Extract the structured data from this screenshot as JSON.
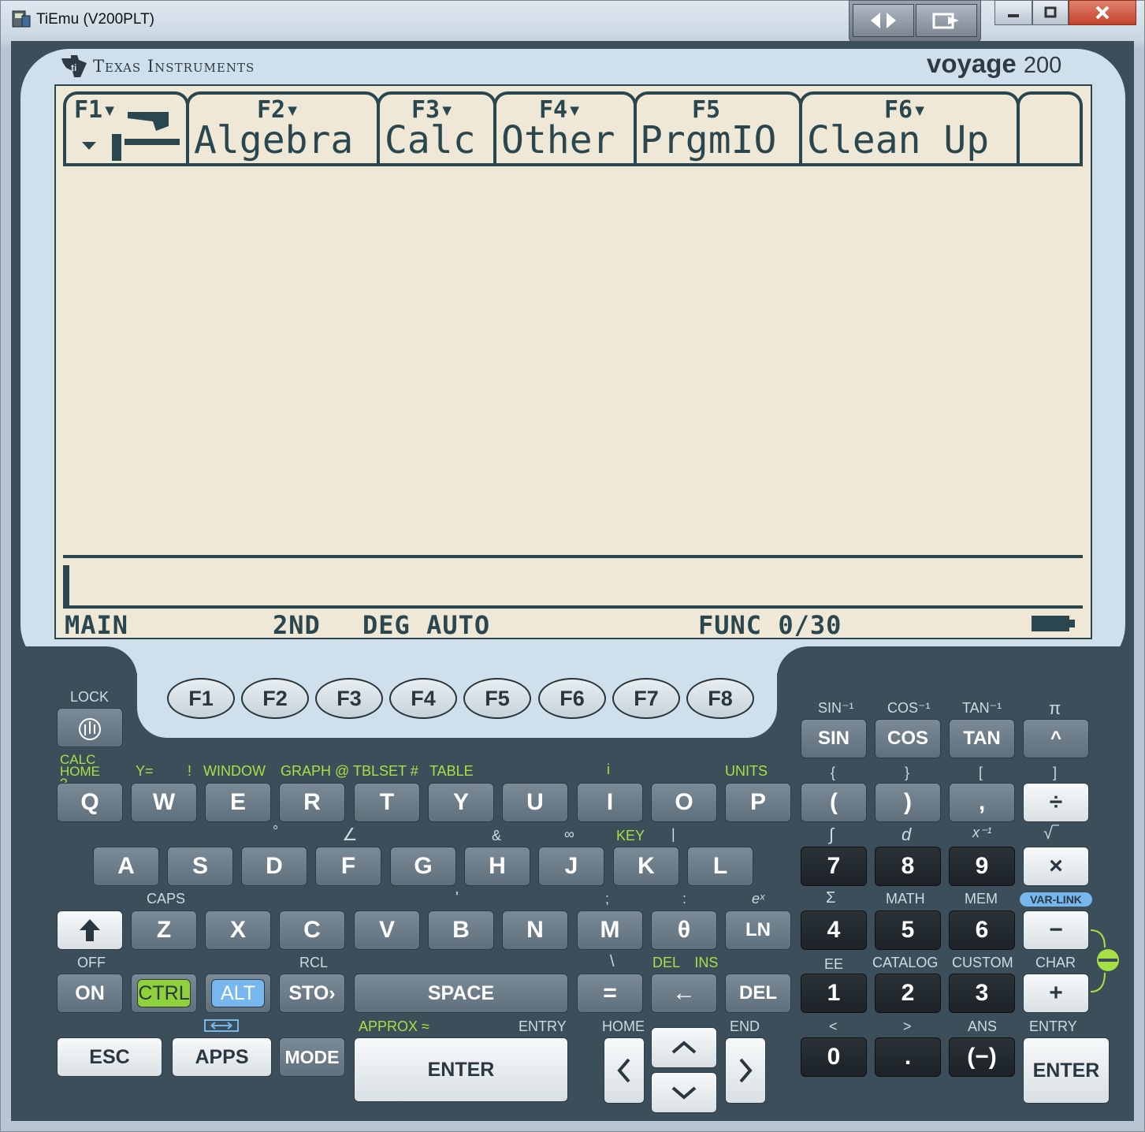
{
  "window": {
    "title": "TiEmu (V200PLT)",
    "buttons": {
      "minimize": "minimize-icon",
      "restore": "restore-icon",
      "close": "close-icon"
    }
  },
  "calculator": {
    "brand": "Texas Instruments",
    "model_name": "voyage",
    "model_number": "200",
    "screen": {
      "toolbar": [
        {
          "fn": "F1▾",
          "label": ""
        },
        {
          "fn": "F2▾",
          "label": "Algebra"
        },
        {
          "fn": "F3▾",
          "label": "Calc"
        },
        {
          "fn": "F4▾",
          "label": "Other"
        },
        {
          "fn": "F5",
          "label": "PrgmIO"
        },
        {
          "fn": "F6▾",
          "label": "Clean Up"
        }
      ],
      "status": {
        "mode": "MAIN",
        "second": "2ND",
        "angle": "DEG AUTO",
        "func": "FUNC 0/30"
      }
    },
    "fkeys": [
      "F1",
      "F2",
      "F3",
      "F4",
      "F5",
      "F6",
      "F7",
      "F8"
    ],
    "keys": {
      "lock": "LOCK",
      "row_sin": [
        {
          "label": "SIN",
          "second": "SIN⁻¹"
        },
        {
          "label": "COS",
          "second": "COS⁻¹"
        },
        {
          "label": "TAN",
          "second": "TAN⁻¹"
        },
        {
          "label": "^",
          "second": "π"
        }
      ],
      "row_q": [
        {
          "label": "Q",
          "second": "CALC HOME ?"
        },
        {
          "label": "W",
          "second": "Y="
        },
        {
          "label": "E",
          "second": "!"
        },
        {
          "label": "R",
          "second": "WINDOW"
        },
        {
          "label": "T",
          "second": "GRAPH @"
        },
        {
          "label": "Y",
          "second": "TBLSET #"
        },
        {
          "label": "U",
          "second": "TABLE"
        },
        {
          "label": "I",
          "second": "i"
        },
        {
          "label": "O",
          "second": ""
        },
        {
          "label": "P",
          "second": "UNITS"
        },
        {
          "label": "(",
          "second": "{"
        },
        {
          "label": ")",
          "second": "}"
        },
        {
          "label": ",",
          "second": "["
        },
        {
          "label": "÷",
          "second": "]"
        }
      ],
      "row_a": [
        {
          "label": "A",
          "second": ""
        },
        {
          "label": "S",
          "second": "°"
        },
        {
          "label": "D",
          "second": ""
        },
        {
          "label": "F",
          "second": "∠"
        },
        {
          "label": "G",
          "second": ""
        },
        {
          "label": "H",
          "second": "&"
        },
        {
          "label": "J",
          "second": "∞"
        },
        {
          "label": "K",
          "second": "KEY"
        },
        {
          "label": "L",
          "second": "|"
        },
        {
          "label": "7",
          "second": "∫"
        },
        {
          "label": "8",
          "second": "d"
        },
        {
          "label": "9",
          "second": "x⁻¹"
        },
        {
          "label": "×",
          "second": "√‾"
        }
      ],
      "row_z": [
        {
          "label": "↑",
          "second": "CAPS"
        },
        {
          "label": "Z",
          "second": ""
        },
        {
          "label": "X",
          "second": ""
        },
        {
          "label": "C",
          "second": ""
        },
        {
          "label": "V",
          "second": ""
        },
        {
          "label": "B",
          "second": "'"
        },
        {
          "label": "N",
          "second": ""
        },
        {
          "label": "M",
          "second": ";"
        },
        {
          "label": "θ",
          "second": ":"
        },
        {
          "label": "LN",
          "second": "eˣ"
        },
        {
          "label": "4",
          "second": "Σ"
        },
        {
          "label": "5",
          "second": "MATH"
        },
        {
          "label": "6",
          "second": "MEM"
        },
        {
          "label": "−",
          "second": "VAR-LINK"
        }
      ],
      "row_on": [
        {
          "label": "ON",
          "second": "OFF"
        },
        {
          "label": "CTRL",
          "second": ""
        },
        {
          "label": "ALT",
          "second": ""
        },
        {
          "label": "STO›",
          "second": "RCL"
        },
        {
          "label": "SPACE",
          "second": ""
        },
        {
          "label": "=",
          "second": "\\"
        },
        {
          "label": "←",
          "second": "DEL INS"
        },
        {
          "label": "DEL",
          "second": ""
        },
        {
          "label": "1",
          "second": "EE"
        },
        {
          "label": "2",
          "second": "CATALOG"
        },
        {
          "label": "3",
          "second": "CUSTOM"
        },
        {
          "label": "+",
          "second": "CHAR"
        }
      ],
      "row_esc": [
        {
          "label": "ESC",
          "second": ""
        },
        {
          "label": "APPS",
          "second": ""
        },
        {
          "label": "MODE",
          "second": ""
        },
        {
          "label": "ENTER",
          "second": "APPROX ≈",
          "third": "ENTRY"
        },
        {
          "label": "0",
          "second": "<"
        },
        {
          "label": ".",
          "second": ">"
        },
        {
          "label": "(−)",
          "second": "ANS"
        },
        {
          "label": "ENTER",
          "second": "ENTRY"
        }
      ],
      "nav": {
        "home": "HOME",
        "end": "END"
      }
    }
  }
}
